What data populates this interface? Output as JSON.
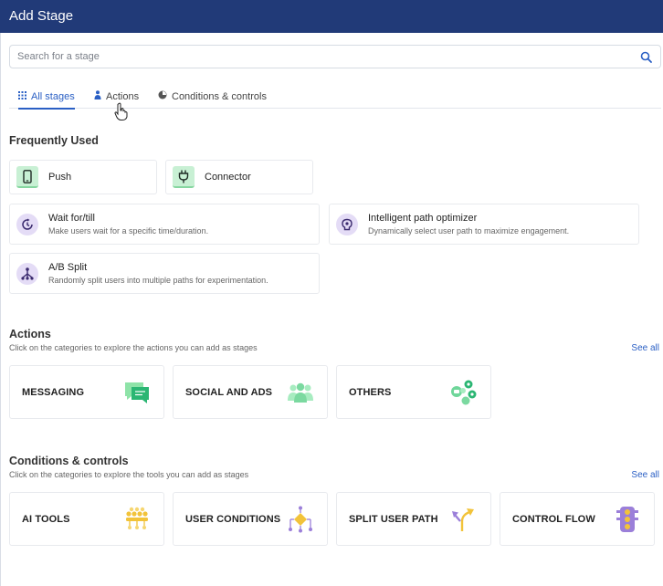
{
  "window": {
    "title": "Add Stage"
  },
  "search": {
    "placeholder": "Search for a stage"
  },
  "tabs": [
    {
      "label": "All stages",
      "active": true
    },
    {
      "label": "Actions",
      "active": false
    },
    {
      "label": "Conditions & controls",
      "active": false
    }
  ],
  "frequently_used": {
    "title": "Frequently Used",
    "items": [
      {
        "title": "Push",
        "icon": "phone-icon"
      },
      {
        "title": "Connector",
        "icon": "plug-icon"
      },
      {
        "title": "Wait for/till",
        "description": "Make users wait for a specific time/duration.",
        "icon": "clock-icon"
      },
      {
        "title": "Intelligent path optimizer",
        "description": "Dynamically select user path to maximize engagement.",
        "icon": "brain-icon"
      },
      {
        "title": "A/B Split",
        "description": "Randomly split users into multiple paths for experimentation.",
        "icon": "split-icon"
      }
    ]
  },
  "actions": {
    "title": "Actions",
    "subtitle": "Click on the categories to explore the actions you can add as stages",
    "see_all": "See all",
    "categories": [
      {
        "label": "MESSAGING",
        "icon": "chat-icon"
      },
      {
        "label": "SOCIAL AND ADS",
        "icon": "people-icon"
      },
      {
        "label": "OTHERS",
        "icon": "apps-cluster-icon"
      }
    ]
  },
  "conditions": {
    "title": "Conditions & controls",
    "subtitle": "Click on the categories to explore the tools you can add as stages",
    "see_all": "See all",
    "categories": [
      {
        "label": "AI TOOLS",
        "icon": "ai-network-icon"
      },
      {
        "label": "USER CONDITIONS",
        "icon": "decision-diamond-icon"
      },
      {
        "label": "SPLIT USER PATH",
        "icon": "split-arrow-icon"
      },
      {
        "label": "CONTROL FLOW",
        "icon": "traffic-light-icon"
      }
    ]
  },
  "colors": {
    "header": "#213a78",
    "accent": "#2a5fc4",
    "green_icon_bg": "#c8f0d4",
    "purple_icon_bg": "#e4dcf6"
  }
}
